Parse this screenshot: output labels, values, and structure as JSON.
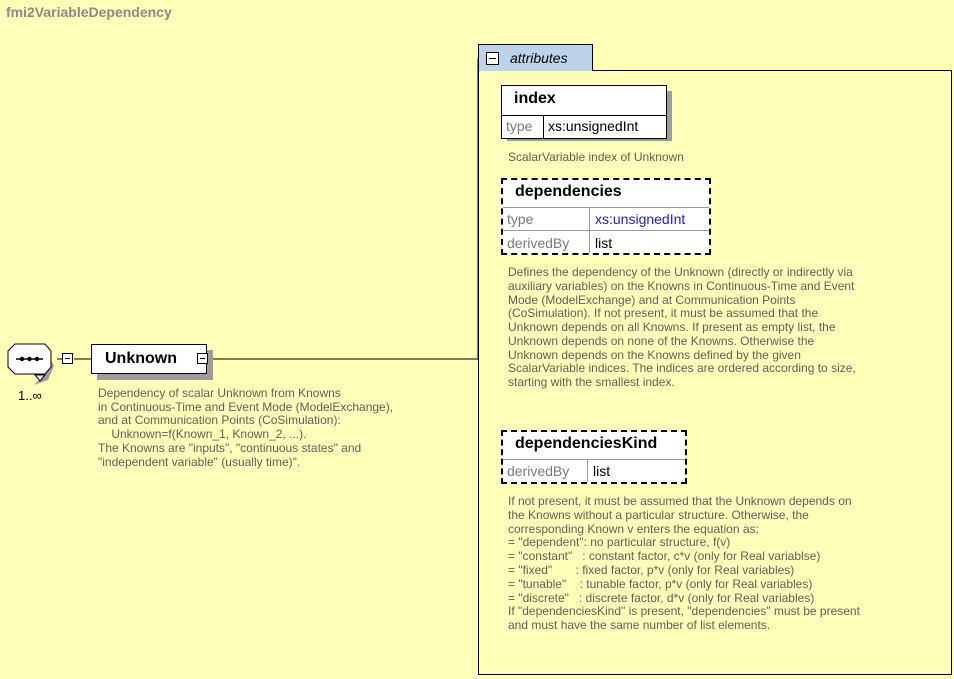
{
  "diagram": {
    "title": "fmi2VariableDependency"
  },
  "sequence": {
    "multiplicity": "1..∞"
  },
  "element": {
    "name": "Unknown",
    "description": "Dependency of scalar Unknown from Knowns\nin Continuous-Time and Event Mode (ModelExchange),\nand at Communication Points (CoSimulation):\n    Unknown=f(Known_1, Known_2, ...).\nThe Knowns are \"inputs\", \"continuous states\" and\n\"independent variable\" (usually time)\"."
  },
  "attributes_group": {
    "label": "attributes",
    "items": [
      {
        "name": "index",
        "optional": false,
        "props": [
          {
            "key": "type",
            "value": "xs:unsignedInt"
          }
        ],
        "description": "ScalarVariable index of Unknown"
      },
      {
        "name": "dependencies",
        "optional": true,
        "props": [
          {
            "key": "type",
            "value": "xs:unsignedInt"
          },
          {
            "key": "derivedBy",
            "value": "list"
          }
        ],
        "description": "Defines the dependency of the Unknown (directly or indirectly via\nauxiliary variables) on the Knowns in Continuous-Time and Event\nMode (ModelExchange) and at Communication Points\n(CoSimulation). If not present, it must be assumed that the\nUnknown depends on all Knowns. If present as empty list, the\nUnknown depends on none of the Knowns. Otherwise the\nUnknown depends on the Knowns defined by the given\nScalarVariable indices. The indices are ordered according to size,\nstarting with the smallest index."
      },
      {
        "name": "dependenciesKind",
        "optional": true,
        "props": [
          {
            "key": "derivedBy",
            "value": "list"
          }
        ],
        "description": "If not present, it must be assumed that the Unknown depends on\nthe Knowns without a particular structure. Otherwise, the\ncorresponding Known v enters the equation as:\n= \"dependent\": no particular structure, f(v)\n= \"constant\"   : constant factor, c*v (only for Real variablse)\n= \"fixed\"       : fixed factor, p*v (only for Real variables)\n= \"tunable\"    : tunable factor, p*v (only for Real variables)\n= \"discrete\"   : discrete factor, d*v (only for Real variables)\nIf \"dependenciesKind\" is present, \"dependencies\" must be present\nand must have the same number of list elements."
      }
    ]
  },
  "colors": {
    "background": "#fffeb8",
    "group_tab": "#bdd3ea",
    "type_link": "#1a1ae6"
  }
}
